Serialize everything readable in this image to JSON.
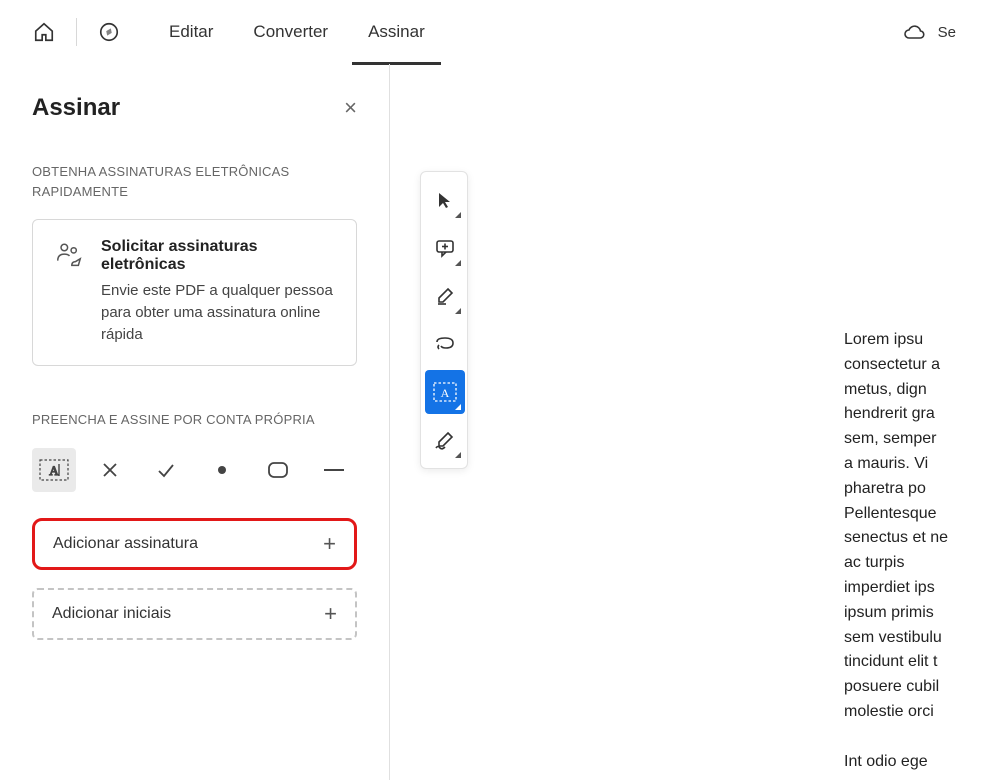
{
  "topbar": {
    "tabs": [
      "Editar",
      "Converter",
      "Assinar"
    ],
    "active_tab_index": 2,
    "right_label": "Se"
  },
  "sidebar": {
    "title": "Assinar",
    "section1_label": "OBTENHA ASSINATURAS ELETRÔNICAS RAPIDAMENTE",
    "card": {
      "title": "Solicitar assinaturas eletrônicas",
      "desc": "Envie este PDF a qualquer pessoa para obter uma assinatura online rápida"
    },
    "section2_label": "PREENCHA E ASSINE POR CONTA PRÓPRIA",
    "add_signature": "Adicionar assinatura",
    "add_initials": "Adicionar iniciais"
  },
  "document": {
    "text": "Lorem ipsu\nconsectetur a\nmetus, dign\nhendrerit gra\nsem, semper \na mauris. Vi\npharetra po\nPellentesque \nsenectus et ne\nac turpis \nimperdiet ips\nipsum primis \nsem vestibulu\ntincidunt elit t\nposuere cubil\nmolestie orci \n\nInt odio ege\nposuere var\nporta mollis. \nsollicitudin. Ph\nNam bibendu"
  }
}
